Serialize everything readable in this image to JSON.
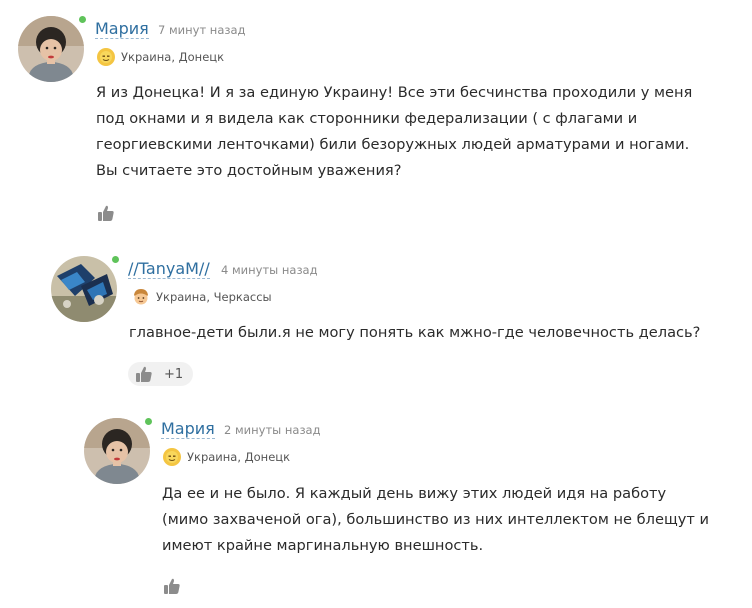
{
  "comments": [
    {
      "author": "Мария",
      "time": "7 минут назад",
      "location": "Украина, Донецк",
      "location_icon": "sun-emoji-icon",
      "text": "Я из Донецка! И я за единую Украину! Все эти бесчинства проходили у меня под окнами и я видела как сторонники федерализации ( с флагами и георгиевскими ленточками) били безоружных людей арматурами и ногами. Вы считаете это достойным уважения?",
      "likes": ""
    },
    {
      "author": "//TanyaM//",
      "time": "4 минуты назад",
      "location": "Украина, Черкассы",
      "location_icon": "face-emoji-icon",
      "text": "главное-дети были.я не могу понять как мжно-где человечность делась?",
      "likes": "+1"
    },
    {
      "author": "Мария",
      "time": "2 минуты назад",
      "location": "Украина, Донецк",
      "location_icon": "sun-emoji-icon",
      "text": "Да ее и не было. Я каждый день вижу этих людей идя на работу (мимо захваченой ога), большинство из них интеллектом не блещут и имеют крайне маргинальную внешность.",
      "likes": ""
    }
  ],
  "colors": {
    "author_link": "#2f6fa0",
    "online": "#5fc35a",
    "time": "#8a8a8a"
  }
}
